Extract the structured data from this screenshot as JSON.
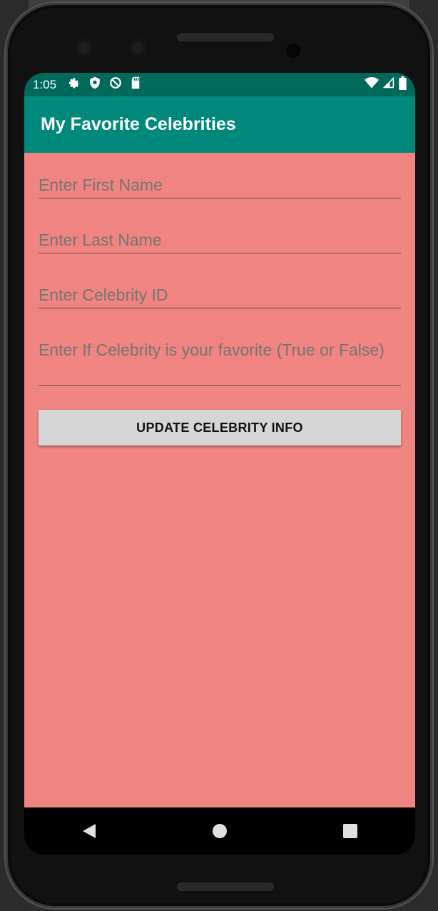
{
  "status_bar": {
    "time": "1:05",
    "left_icons": [
      "gear-icon",
      "shield-icon",
      "no-entry-icon",
      "sd-card-icon"
    ],
    "right_icons": [
      "wifi-icon",
      "signal-icon",
      "battery-icon"
    ]
  },
  "app_bar": {
    "title": "My Favorite Celebrities"
  },
  "form": {
    "first_name_placeholder": "Enter First Name",
    "last_name_placeholder": "Enter Last Name",
    "celebrity_id_placeholder": "Enter Celebrity ID",
    "favorite_placeholder": "Enter If Celebrity is your favorite (True or False)",
    "update_button_label": "UPDATE CELEBRITY INFO"
  },
  "nav_bar": {
    "icons": [
      "back-icon",
      "home-icon",
      "recents-icon"
    ]
  },
  "colors": {
    "status_bar": "#00695c",
    "app_bar": "#00897b",
    "content_background": "#f08480",
    "button_background": "#d6d6d6"
  }
}
